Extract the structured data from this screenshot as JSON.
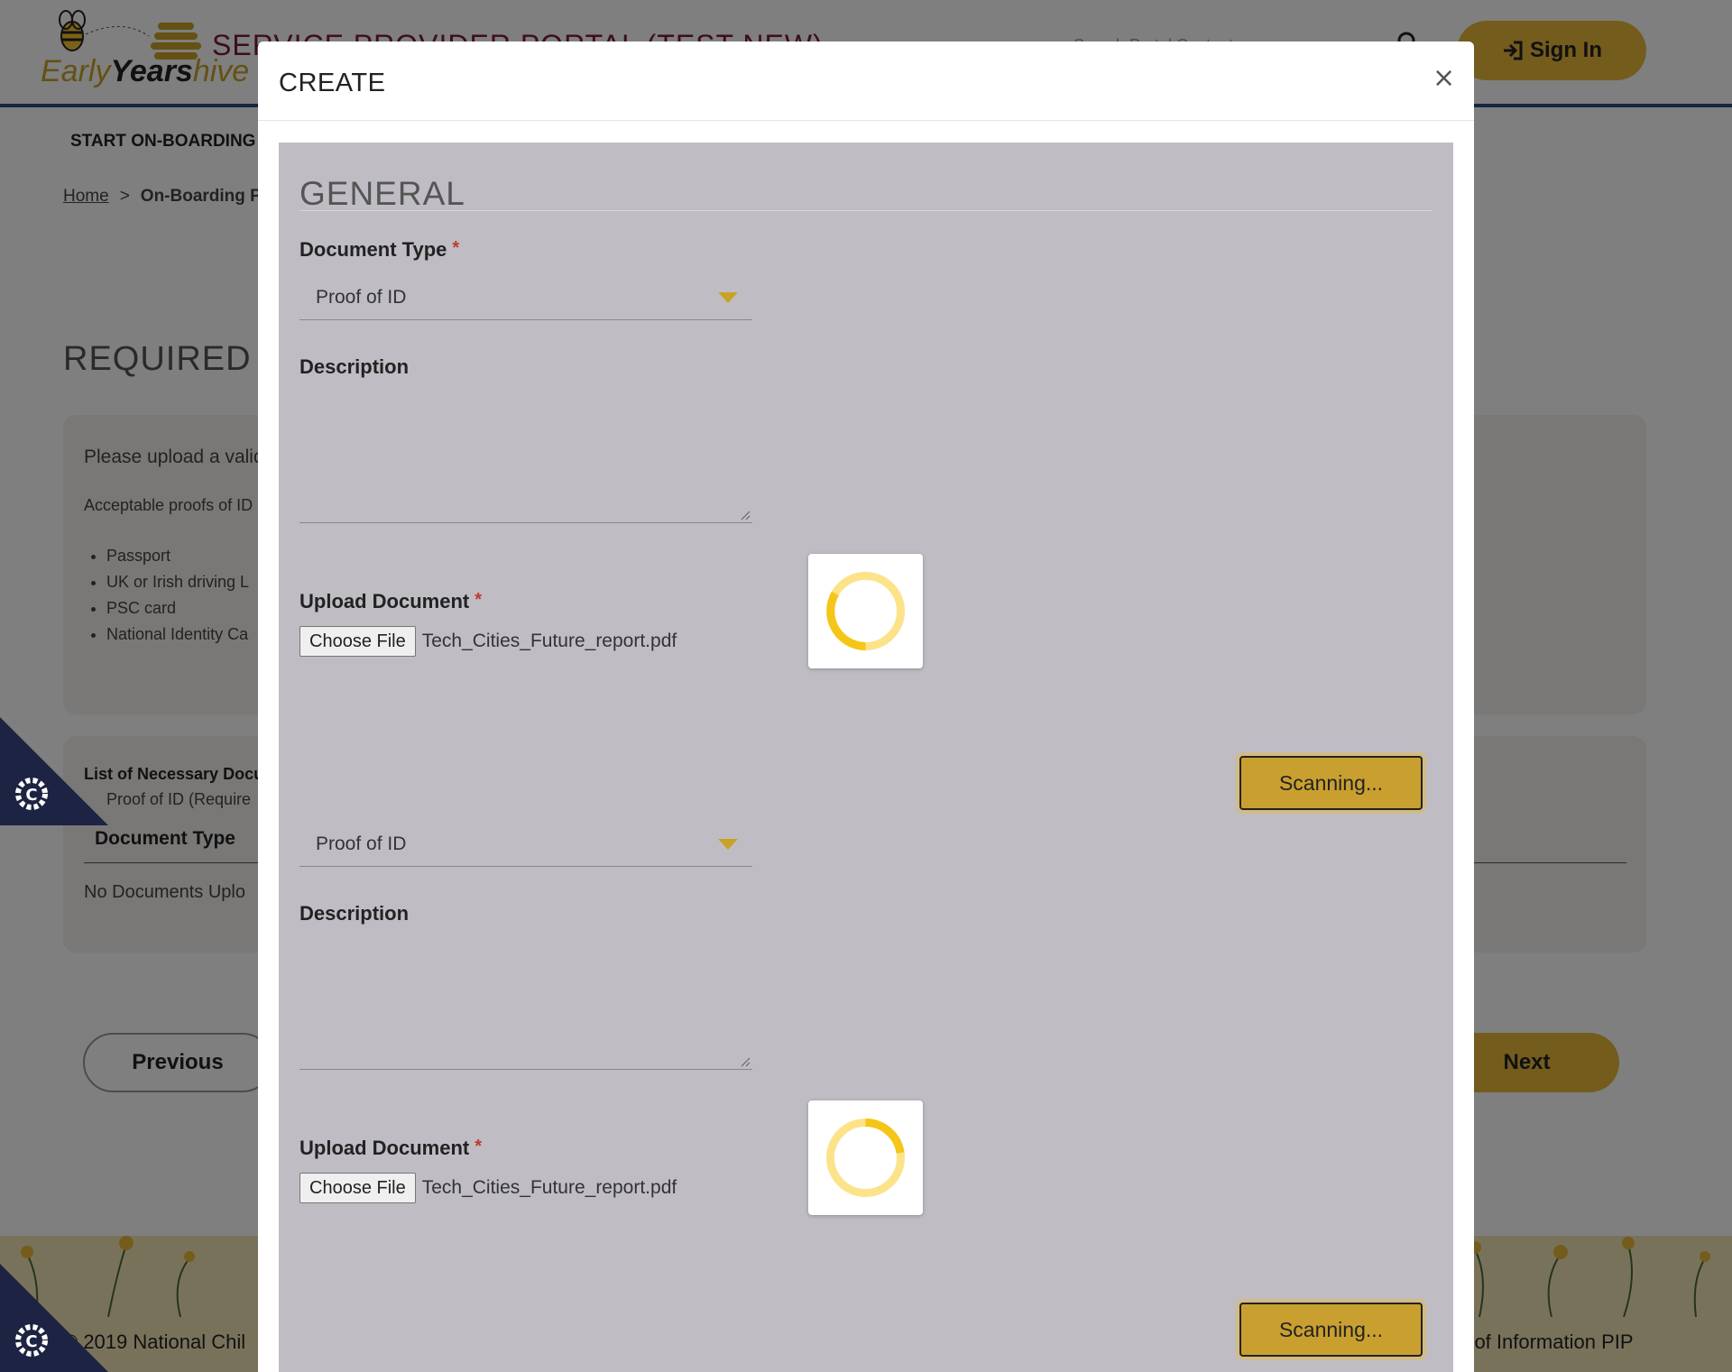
{
  "header": {
    "logo_text_early": "Early",
    "logo_text_years": "Years",
    "logo_text_hive": "hive",
    "portal_title": "SERVICE PROVIDER PORTAL (TEST NEW)",
    "search_placeholder": "Search Portal Content",
    "signin_label": "Sign In"
  },
  "nav": {
    "start_onboarding": "START ON-BOARDING"
  },
  "breadcrumb": {
    "home": "Home",
    "separator": ">",
    "current": "On-Boarding P"
  },
  "main": {
    "required_title": "REQUIRED D",
    "panel1": {
      "line1": "Please upload a valid",
      "line2": "Acceptable proofs of ID",
      "items": [
        "Passport",
        "UK or Irish driving L",
        "PSC card",
        "National Identity Ca"
      ]
    },
    "panel2": {
      "list_title": "List of Necessary Docu",
      "list_item": "Proof of ID (Require",
      "column_document_type": "Document Type",
      "empty_text": "No Documents Uplo"
    },
    "previous_label": "Previous",
    "next_label": "Next"
  },
  "footer": {
    "copyright": "© 2019 National Chil",
    "links": "m of Information  PIP"
  },
  "modal": {
    "title": "CREATE",
    "close_symbol": "×",
    "section_title": "GENERAL",
    "groups": [
      {
        "document_type_label": "Document Type",
        "document_type_value": "Proof of ID",
        "description_label": "Description",
        "upload_label": "Upload Document",
        "choose_file_label": "Choose File",
        "file_name": "Tech_Cities_Future_report.pdf",
        "scan_button_label": "Scanning..."
      },
      {
        "document_type_value": "Proof of ID",
        "description_label": "Description",
        "upload_label": "Upload Document",
        "choose_file_label": "Choose File",
        "file_name": "Tech_Cities_Future_report.pdf",
        "scan_button_label": "Scanning..."
      }
    ],
    "required_marker": "*"
  },
  "colors": {
    "accent_gold": "#e8b93a",
    "scan_gold": "#c9a02f",
    "form_bg": "#bfbdc3",
    "required_red": "#c0392b",
    "cookie_navy": "#1d2342"
  }
}
